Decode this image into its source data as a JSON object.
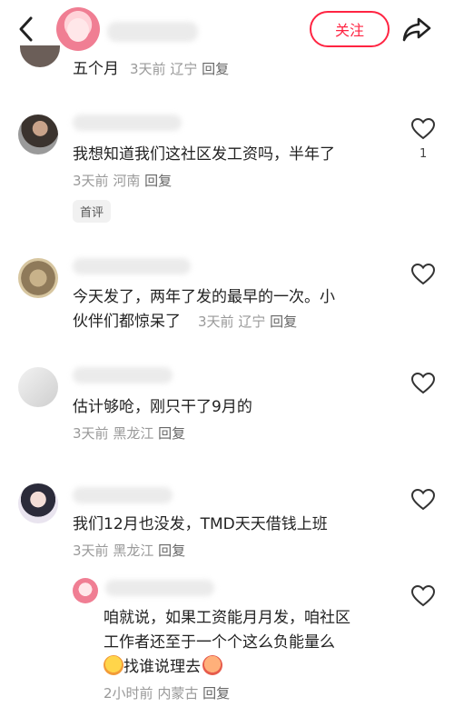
{
  "header": {
    "follow_label": "关注",
    "icons": [
      "chevron-left-icon",
      "share-icon"
    ]
  },
  "comments": [
    {
      "text": "五个月",
      "time": "3天前",
      "location": "辽宁",
      "reply": "回复"
    },
    {
      "text": "我想知道我们这社区发工资吗，半年了",
      "time": "3天前",
      "location": "河南",
      "reply": "回复",
      "likes": "1",
      "badge": "首评"
    },
    {
      "text_line1": "今天发了，两年了发的最早的一次。小",
      "text_line2": "伙伴们都惊呆了",
      "time": "3天前",
      "location": "辽宁",
      "reply": "回复"
    },
    {
      "text": "估计够呛，刚只干了9月的",
      "time": "3天前",
      "location": "黑龙江",
      "reply": "回复"
    },
    {
      "text": "我们12月也没发，TMD天天借钱上班",
      "time": "3天前",
      "location": "黑龙江",
      "reply": "回复"
    }
  ],
  "sub_reply": {
    "line1": "咱就说，如果工资能月月发，咱社区",
    "line2": "工作者还至于一个个这么负能量么",
    "line3": "找谁说理去",
    "time": "2小时前",
    "location": "内蒙古",
    "reply": "回复"
  },
  "colors": {
    "accent": "#ff2442",
    "meta": "#999999",
    "text": "#222222"
  }
}
